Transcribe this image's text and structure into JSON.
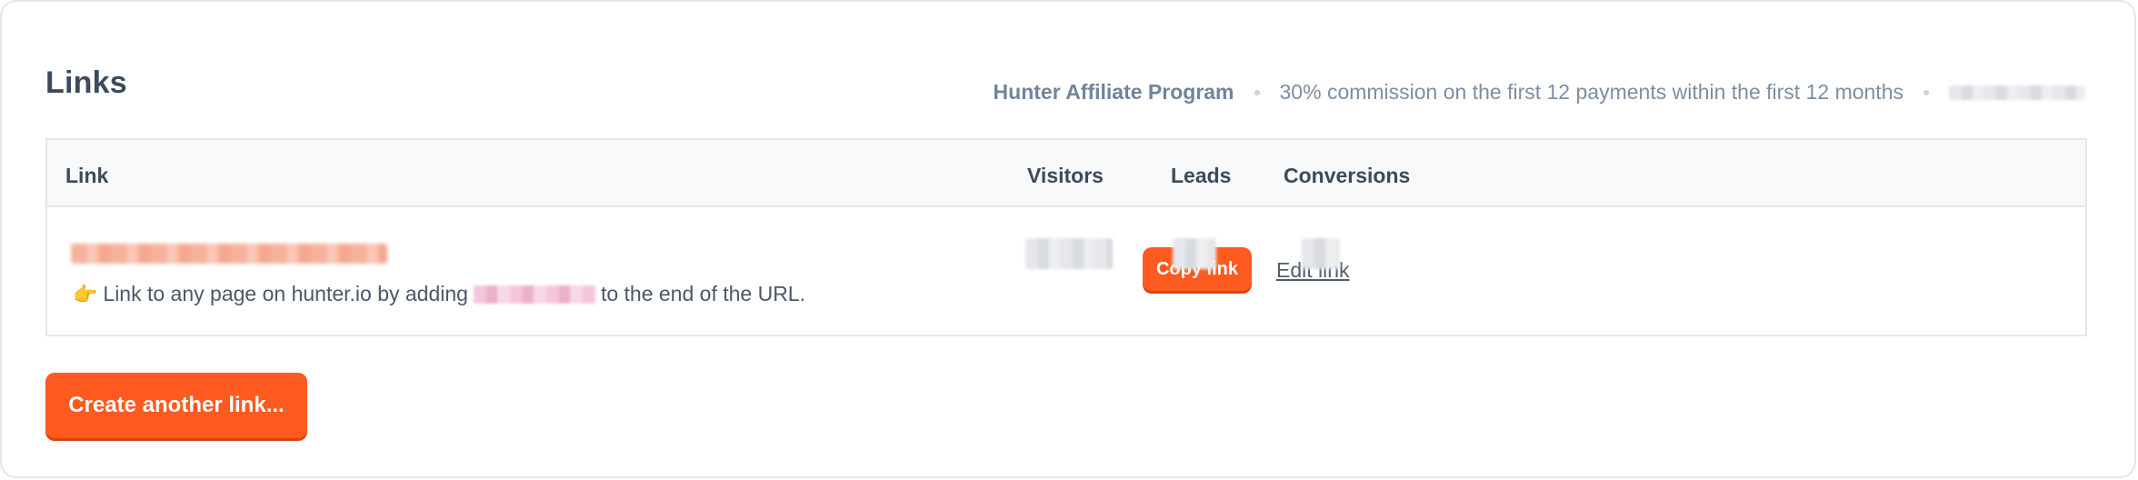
{
  "card": {
    "title": "Links",
    "program": {
      "name": "Hunter Affiliate Program",
      "commission": "30% commission on the first 12 payments within the first 12 months"
    }
  },
  "table": {
    "columns": [
      "Link",
      "Visitors",
      "Leads",
      "Conversions"
    ],
    "rows": [
      {
        "hint_prefix": "Link to any page on hunter.io by adding",
        "hint_suffix": "to the end of the URL.",
        "copy_label": "Copy link",
        "edit_label": "Edit link"
      }
    ]
  },
  "actions": {
    "create_label": "Create another link..."
  },
  "colors": {
    "accent": "#ff5a1f",
    "heading": "#3c4b5c",
    "muted": "#7d8ea3",
    "border": "#e3e8ee"
  },
  "icons": {
    "hint_icon": "pointing-hand-icon"
  }
}
